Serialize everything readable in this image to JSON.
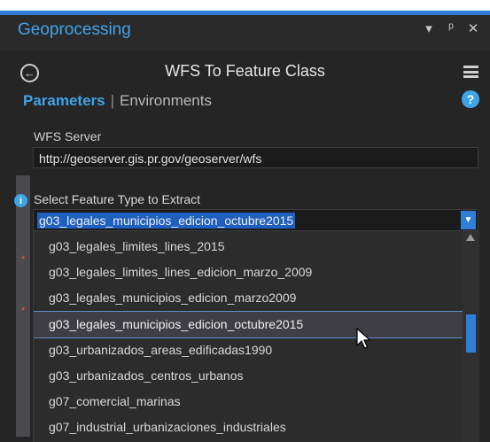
{
  "window": {
    "pane_title": "Geoprocessing",
    "controls": [
      "▾",
      "ᵖ",
      "✕"
    ]
  },
  "tool": {
    "title": "WFS To Feature Class",
    "back_icon": "back-arrow-icon",
    "menu_icon": "hamburger-menu-icon"
  },
  "tabs": {
    "active": "Parameters",
    "separator": "|",
    "inactive": "Environments",
    "help_icon": "?"
  },
  "wfs_server": {
    "label": "WFS Server",
    "value": "http://geoserver.gis.pr.gov/geoserver/wfs"
  },
  "feature_type": {
    "info_icon": "i",
    "label": "Select Feature Type to Extract",
    "selected": "g03_legales_municipios_edicion_octubre2015",
    "options": [
      "g03_legales_limites_lines_2015",
      "g03_legales_limites_lines_edicion_marzo_2009",
      "g03_legales_municipios_edicion_marzo2009",
      "g03_legales_municipios_edicion_octubre2015",
      "g03_urbanizados_areas_edificadas1990",
      "g03_urbanizados_centros_urbanos",
      "g07_comercial_marinas",
      "g07_industrial_urbanizaciones_industriales"
    ],
    "highlighted_index": 3
  },
  "required_marker": "*",
  "colors": {
    "accent": "#3fa3e8",
    "selection": "#1f5fbf",
    "required": "#e4603f"
  }
}
